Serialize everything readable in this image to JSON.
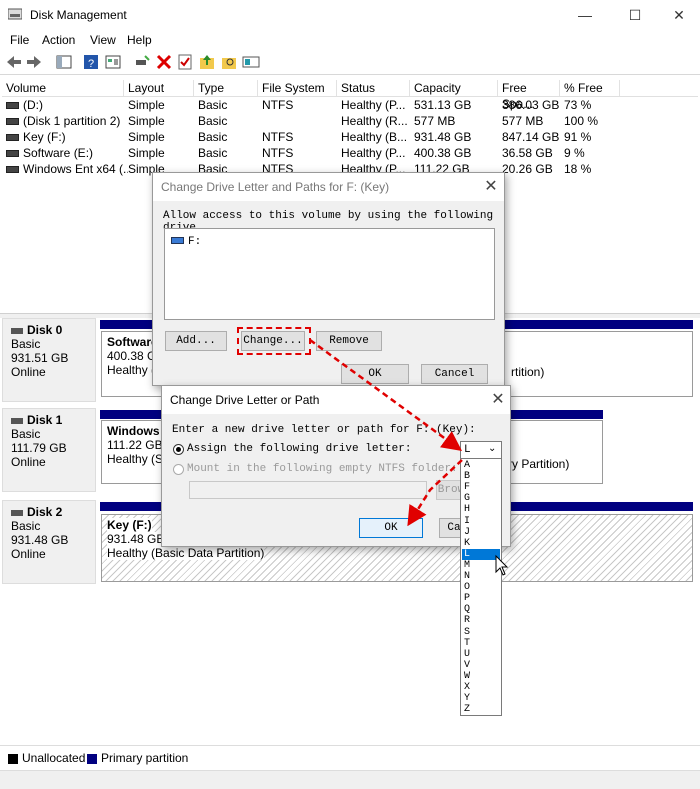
{
  "window": {
    "title": "Disk Management",
    "minimize": "—",
    "maximize": "☐",
    "close": "✕"
  },
  "menu": [
    "File",
    "Action",
    "View",
    "Help"
  ],
  "toolbar_icons": [
    "back-arrow-icon",
    "forward-arrow-icon",
    "console-tree-icon",
    "help-icon",
    "properties-icon",
    "connect-icon",
    "delete-icon",
    "checkmark-icon",
    "folder-up-icon",
    "search-folder-icon",
    "refresh-icon"
  ],
  "volumes": {
    "headers": [
      "Volume",
      "Layout",
      "Type",
      "File System",
      "Status",
      "Capacity",
      "Free Spa...",
      "% Free"
    ],
    "rows": [
      [
        "(D:)",
        "Simple",
        "Basic",
        "NTFS",
        "Healthy (P...",
        "531.13 GB",
        "386.03 GB",
        "73 %"
      ],
      [
        "(Disk 1 partition 2)",
        "Simple",
        "Basic",
        "",
        "Healthy (R...",
        "577 MB",
        "577 MB",
        "100 %"
      ],
      [
        "Key (F:)",
        "Simple",
        "Basic",
        "NTFS",
        "Healthy (B...",
        "931.48 GB",
        "847.14 GB",
        "91 %"
      ],
      [
        "Software (E:)",
        "Simple",
        "Basic",
        "NTFS",
        "Healthy (P...",
        "400.38 GB",
        "36.58 GB",
        "9 %"
      ],
      [
        "Windows Ent x64 (...",
        "Simple",
        "Basic",
        "NTFS",
        "Healthy (P...",
        "111.22 GB",
        "20.26 GB",
        "18 %"
      ]
    ]
  },
  "disks": [
    {
      "name": "Disk 0",
      "type": "Basic",
      "size": "931.51 GB",
      "state": "Online",
      "part_name": "Software",
      "part_size": "400.38 GB",
      "part_status": "Healthy (P",
      "right_status": "rtition)"
    },
    {
      "name": "Disk 1",
      "type": "Basic",
      "size": "111.79 GB",
      "state": "Online",
      "part_name": "Windows E",
      "part_size": "111.22 GB",
      "part_status": "Healthy (Sy",
      "right_status": "ry Partition)"
    },
    {
      "name": "Disk 2",
      "type": "Basic",
      "size": "931.48 GB",
      "state": "Online",
      "part_name": "Key  (F:)",
      "part_size": "931.48 GB NTFS",
      "part_status": "Healthy (Basic Data Partition)"
    }
  ],
  "legend": {
    "unallocated": "Unallocated",
    "primary": "Primary partition",
    "unallocated_color": "#000000",
    "primary_color": "#010080"
  },
  "dialog1": {
    "title": "Change Drive Letter and Paths for F: (Key)",
    "label": "Allow access to this volume by using the following drive",
    "list_item": "F:",
    "add": "Add...",
    "change": "Change...",
    "remove": "Remove",
    "ok": "OK",
    "cancel": "Cancel"
  },
  "dialog2": {
    "title": "Change Drive Letter or Path",
    "prompt": "Enter a new drive letter or path for F: (Key):",
    "assign": "Assign the following drive letter:",
    "mount": "Mount in the following empty NTFS folder:",
    "browse": "Brow",
    "ok": "OK",
    "cancel": "Ca",
    "selected_letter": "L"
  },
  "letters": [
    "A",
    "B",
    "F",
    "G",
    "H",
    "I",
    "J",
    "K",
    "L",
    "M",
    "N",
    "O",
    "P",
    "Q",
    "R",
    "S",
    "T",
    "U",
    "V",
    "W",
    "X",
    "Y",
    "Z"
  ],
  "selected_index": 8,
  "annotation_color": "#e00000"
}
